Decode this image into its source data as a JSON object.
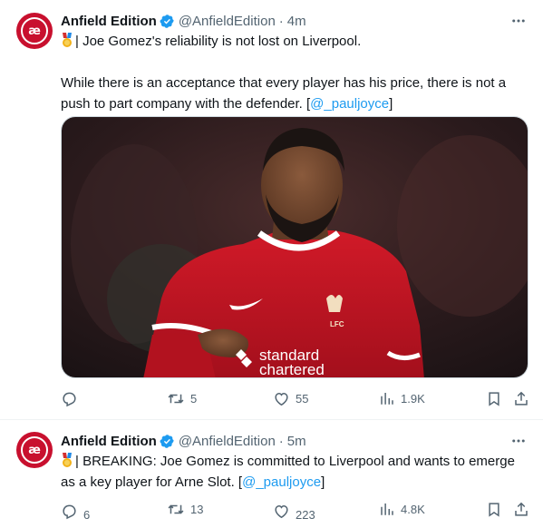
{
  "tweets": [
    {
      "author": "Anfield Edition",
      "handle": "@AnfieldEdition",
      "separator": "·",
      "time": "4m",
      "line1": "| Joe Gomez's reliability is not lost on Liverpool.",
      "line2_prefix": "While there is an acceptance that every player has his price, there is not a push to part company with the defender. [",
      "line2_link": "@_pauljoyce",
      "line2_suffix": "]",
      "media": {
        "alt": "Joe Gomez in Liverpool home kit",
        "sponsor_line1": "standard",
        "sponsor_line2": "chartered",
        "crest_text": "LFC"
      },
      "stats": {
        "replies": "",
        "reposts": "5",
        "likes": "55",
        "views": "1.9K"
      }
    },
    {
      "author": "Anfield Edition",
      "handle": "@AnfieldEdition",
      "separator": "·",
      "time": "5m",
      "body_prefix": "| BREAKING: Joe Gomez is committed to Liverpool and wants to emerge as a key player for Arne Slot. [",
      "body_link": "@_pauljoyce",
      "body_suffix": "]",
      "stats": {
        "replies": "6",
        "reposts": "13",
        "likes": "223",
        "views": "4.8K"
      }
    }
  ],
  "avatar_text": "æ",
  "colors": {
    "brand": "#c8102e",
    "link": "#1d9bf0",
    "muted": "#536471",
    "verified": "#1d9bf0"
  }
}
